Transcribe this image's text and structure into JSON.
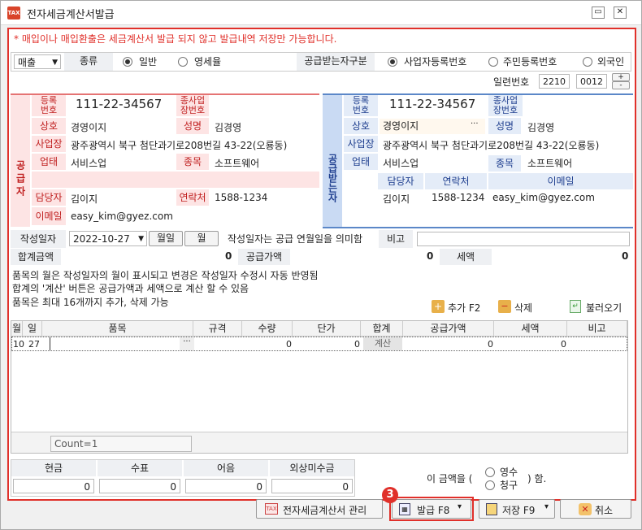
{
  "window": {
    "title": "전자세금계산서발급",
    "min": "▭",
    "close": "✕",
    "icon_text": "TAX"
  },
  "notice": "* 매입이나 매입환출은 세금계산서 발급 되지 않고 발급내역 저장만 가능합니다.",
  "top": {
    "type_select": "매출",
    "kind_label": "종류",
    "kind_normal": "일반",
    "kind_zero": "영세율",
    "recv_label": "공급받는자구분",
    "recv_biz": "사업자등록번호",
    "recv_resident": "주민등록번호",
    "recv_foreign": "외국인"
  },
  "serial": {
    "label": "일련번호",
    "v1": "2210",
    "v2": "0012",
    "plus": "+",
    "minus": "-"
  },
  "supplier": {
    "side": "공급자",
    "reg_label": "등록\n번호",
    "reg": "111-22-34567",
    "sub_label": "종사업\n장번호",
    "name_label": "상호",
    "name": "경영이지",
    "ceo_label": "성명",
    "ceo": "김경영",
    "addr_label": "사업장",
    "addr": "광주광역시 북구 첨단과기로208번길 43-22(오룡동)",
    "type_label": "업태",
    "type": "서비스업",
    "item_label": "종목",
    "item": "소프트웨어",
    "mgr_label": "담당자",
    "mgr": "김이지",
    "tel_label": "연락처",
    "tel": "1588-1234",
    "email_label": "이메일",
    "email": "easy_kim@gyez.com"
  },
  "receiver": {
    "side": "공급받는자",
    "reg_label": "등록\n번호",
    "reg": "111-22-34567",
    "sub_label": "종사업\n장번호",
    "name_label": "상호",
    "name": "경영이지",
    "dots": "···",
    "ceo_label": "성명",
    "ceo": "김경영",
    "addr_label": "사업장",
    "addr": "광주광역시 북구 첨단과기로208번길 43-22(오룡동)",
    "type_label": "업태",
    "type": "서비스업",
    "item_label": "종목",
    "item": "소프트웨어",
    "mgr_label": "담당자",
    "tel_label": "연락처",
    "email_label": "이메일",
    "mgr": "김이지",
    "tel": "1588-1234",
    "email": "easy_kim@gyez.com"
  },
  "date": {
    "label": "작성일자",
    "value": "2022-10-27",
    "btn_month": "월일",
    "btn_mon": "월",
    "hint": "작성일자는 공급 연월일을 의미함",
    "memo_label": "비고",
    "memo": ""
  },
  "totals": {
    "sum_label": "합계금액",
    "sum": "0",
    "supply_label": "공급가액",
    "supply": "0",
    "tax_label": "세액",
    "tax": "0"
  },
  "info": [
    "품목의 월은 작성일자의 월이 표시되고 변경은 작성일자 수정시 자동 반영됨",
    "합계의 '계산' 버튼은 공급가액과 세액으로 계산 할 수 있음",
    "품목은 최대 16개까지 추가, 삭제 가능"
  ],
  "actions": {
    "add": "추가 F2",
    "del": "삭제",
    "load": "불러오기"
  },
  "grid": {
    "headers": [
      "월",
      "일",
      "품목",
      "규격",
      "수량",
      "단가",
      "합계",
      "공급가액",
      "세액",
      "비고"
    ],
    "row": {
      "month": "10",
      "day": "27",
      "item": "",
      "dots": "···",
      "spec": "",
      "qty": "0",
      "price": "0",
      "calc": "계산",
      "supply": "0",
      "tax": "0",
      "memo": ""
    },
    "count": "Count=1"
  },
  "pay": {
    "cash_label": "현금",
    "check_label": "수표",
    "note_label": "어음",
    "credit_label": "외상미수금",
    "cash": "0",
    "check": "0",
    "note": "0",
    "credit": "0",
    "claim_prefix": "이 금액을 (",
    "receipt": "영수",
    "claim": "청구",
    "claim_suffix": ") 함."
  },
  "bottom": {
    "manage": "전자세금계산서 관리",
    "issue": "발급 F8",
    "save": "저장 F9",
    "cancel": "취소",
    "badge": "3",
    "arrow": "▾"
  },
  "colors": {
    "accent_red": "#e0302a",
    "supplier_bg": "#fde4e4",
    "receiver_bg": "#e4ecf8",
    "badge": "#e0302a"
  }
}
